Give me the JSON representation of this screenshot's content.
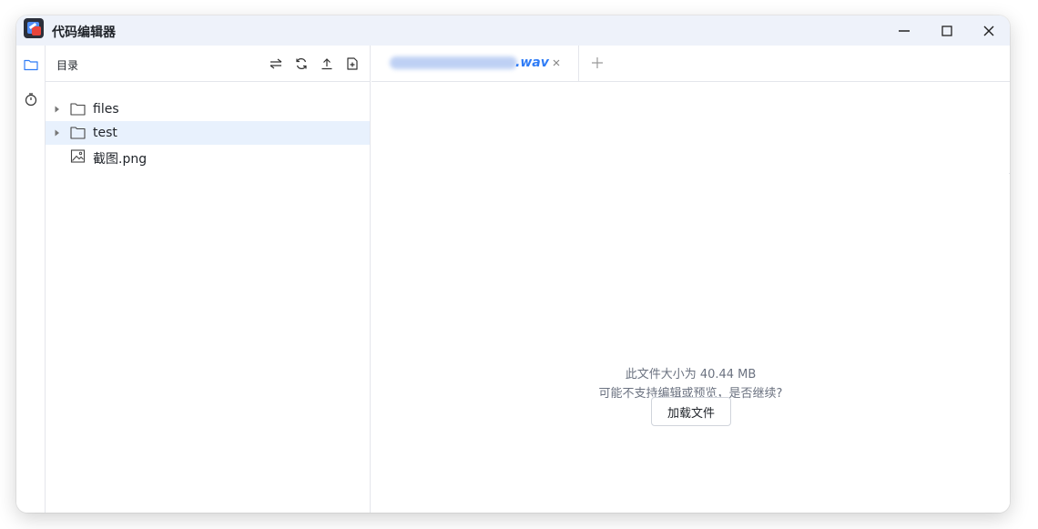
{
  "window": {
    "title": "代码编辑器",
    "controls": [
      "minimize-icon",
      "maximize-icon",
      "close-icon"
    ]
  },
  "activity_bar": {
    "items": [
      {
        "icon": "folder-icon",
        "active": true
      },
      {
        "icon": "timer-icon",
        "active": false
      }
    ]
  },
  "explorer": {
    "title": "目录",
    "toolbar": [
      "collapse-icon",
      "refresh-icon",
      "upload-icon",
      "new-file-icon"
    ],
    "tree": [
      {
        "type": "folder",
        "label": "files",
        "selected": false
      },
      {
        "type": "folder",
        "label": "test",
        "selected": true
      },
      {
        "type": "image",
        "label": "截图.png",
        "selected": false
      }
    ]
  },
  "editor": {
    "tabs": [
      {
        "label": ".wav",
        "active": true
      }
    ],
    "notice": {
      "line1": "此文件大小为 40.44 MB",
      "line2": "可能不支持编辑或预览，是否继续?",
      "button": "加载文件"
    }
  },
  "colors": {
    "accent": "#2f7cf6",
    "titlebar_bg": "#eef2fa",
    "selected_row": "#e8f1fd",
    "border": "#e4e6eb"
  }
}
